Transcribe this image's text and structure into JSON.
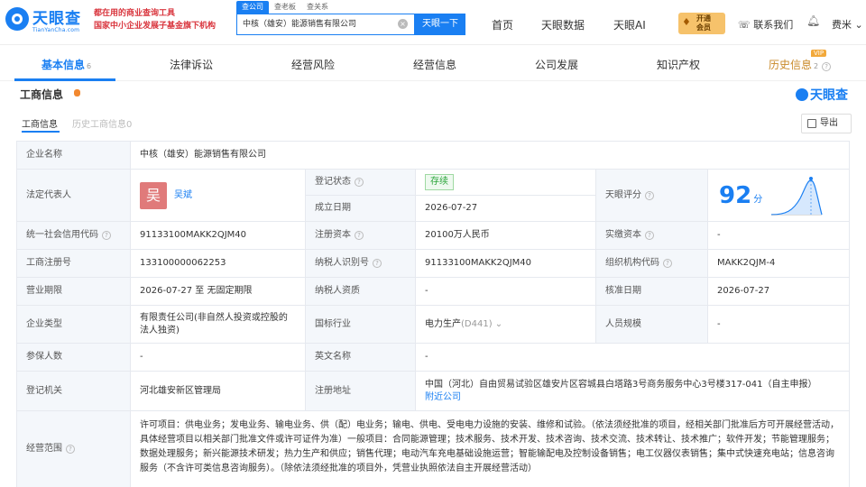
{
  "brand": {
    "logo_text": "天眼查",
    "logo_sub": "TianYanCha.com",
    "slogan_line1": "都在用的商业查询工具",
    "slogan_line2": "国家中小企业发展子基金旗下机构"
  },
  "search": {
    "tabs": [
      "查公司",
      "查老板",
      "查关系"
    ],
    "value": "中核（雄安）能源销售有限公司",
    "button": "天眼一下"
  },
  "topnav": {
    "items": [
      "首页",
      "天眼数据",
      "天眼AI"
    ],
    "vip_line1": "开通",
    "vip_line2": "会员",
    "contact": "联系我们",
    "user": "费米"
  },
  "modules": {
    "tabs": [
      {
        "label": "基本信息",
        "count": "6"
      },
      {
        "label": "法律诉讼",
        "count": ""
      },
      {
        "label": "经营风险",
        "count": ""
      },
      {
        "label": "经营信息",
        "count": ""
      },
      {
        "label": "公司发展",
        "count": ""
      },
      {
        "label": "知识产权",
        "count": ""
      },
      {
        "label": "历史信息",
        "count": "2"
      }
    ],
    "vip_tag": "VIP"
  },
  "section": {
    "title": "工商信息",
    "logo": "天眼查",
    "subtab_active": "工商信息",
    "subtab_history": "历史工商信息",
    "subtab_history_count": "0",
    "export": "导出"
  },
  "info": {
    "company_name_label": "企业名称",
    "company_name": "中核（雄安）能源销售有限公司",
    "legal_rep_label": "法定代表人",
    "legal_rep_avatar": "吴",
    "legal_rep": "吴斌",
    "reg_status_label": "登记状态",
    "reg_status": "存续",
    "found_date_label": "成立日期",
    "found_date": "2026-07-27",
    "score_label": "天眼评分",
    "score": "92",
    "score_unit": "分",
    "credit_code_label": "统一社会信用代码",
    "credit_code": "91133100MAKK2QJM40",
    "reg_capital_label": "注册资本",
    "reg_capital": "20100万人民币",
    "paid_capital_label": "实缴资本",
    "paid_capital": "-",
    "reg_no_label": "工商注册号",
    "reg_no": "133100000062253",
    "taxpayer_id_label": "纳税人识别号",
    "taxpayer_id": "91133100MAKK2QJM40",
    "org_code_label": "组织机构代码",
    "org_code": "MAKK2QJM-4",
    "term_label": "营业期限",
    "term": "2026-07-27 至 无固定期限",
    "taxpayer_qual_label": "纳税人资质",
    "taxpayer_qual": "-",
    "approve_date_label": "核准日期",
    "approve_date": "2026-07-27",
    "type_label": "企业类型",
    "type": "有限责任公司(非自然人投资或控股的法人独资)",
    "industry_label": "国标行业",
    "industry": "电力生产",
    "industry_code": "(D441)",
    "staff_size_label": "人员规模",
    "staff_size": "-",
    "insured_label": "参保人数",
    "insured": "-",
    "english_name_label": "英文名称",
    "english_name": "-",
    "authority_label": "登记机关",
    "authority": "河北雄安新区管理局",
    "address_label": "注册地址",
    "address": "中国（河北）自由贸易试验区雄安片区容城县白塔路3号商务服务中心3号楼317-041（自主申报）",
    "nearby": "附近公司",
    "scope_label": "经营范围",
    "scope": "许可项目：供电业务；发电业务、输电业务、供（配）电业务；输电、供电、受电电力设施的安装、维修和试验。（依法须经批准的项目，经相关部门批准后方可开展经营活动，具体经营项目以相关部门批准文件或许可证件为准）一般项目：合同能源管理；技术服务、技术开发、技术咨询、技术交流、技术转让、技术推广；软件开发；节能管理服务；数据处理服务；新兴能源技术研发；热力生产和供应；销售代理；电动汽车充电基础设施运营；智能输配电及控制设备销售；电工仪器仪表销售；集中式快速充电站；信息咨询服务（不含许可类信息咨询服务）。（除依法须经批准的项目外，凭营业执照依法自主开展经营活动）"
  },
  "colors": {
    "accent": "#1a7ff2",
    "label_bg": "#f4f7fb",
    "status_green": "#2aa53a",
    "vip_gold": "#f6c26b"
  }
}
